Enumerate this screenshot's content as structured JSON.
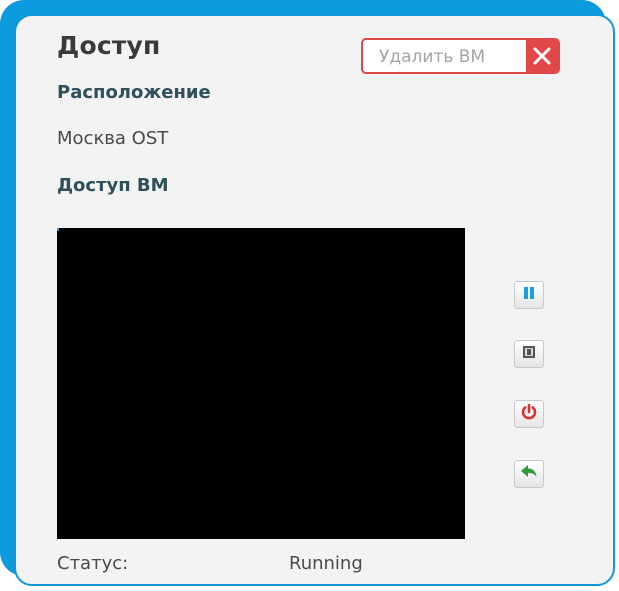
{
  "header": {
    "title": "Доступ",
    "delete_button_label": "Удалить ВМ"
  },
  "location": {
    "label": "Расположение",
    "value": "Москва OST"
  },
  "vm_access": {
    "label": "Доступ ВМ"
  },
  "controls": [
    {
      "name": "pause",
      "icon": "pause-icon"
    },
    {
      "name": "stop",
      "icon": "stop-icon"
    },
    {
      "name": "restart",
      "icon": "power-restart-icon"
    },
    {
      "name": "back",
      "icon": "back-arrow-icon"
    }
  ],
  "status": {
    "label": "Статус:",
    "value": "Running"
  },
  "colors": {
    "frame": "#0d9be0",
    "delete_red": "#e04848",
    "pause_blue": "#1aa0e0",
    "restart_red": "#d8332f",
    "back_green": "#2e9a3a"
  }
}
